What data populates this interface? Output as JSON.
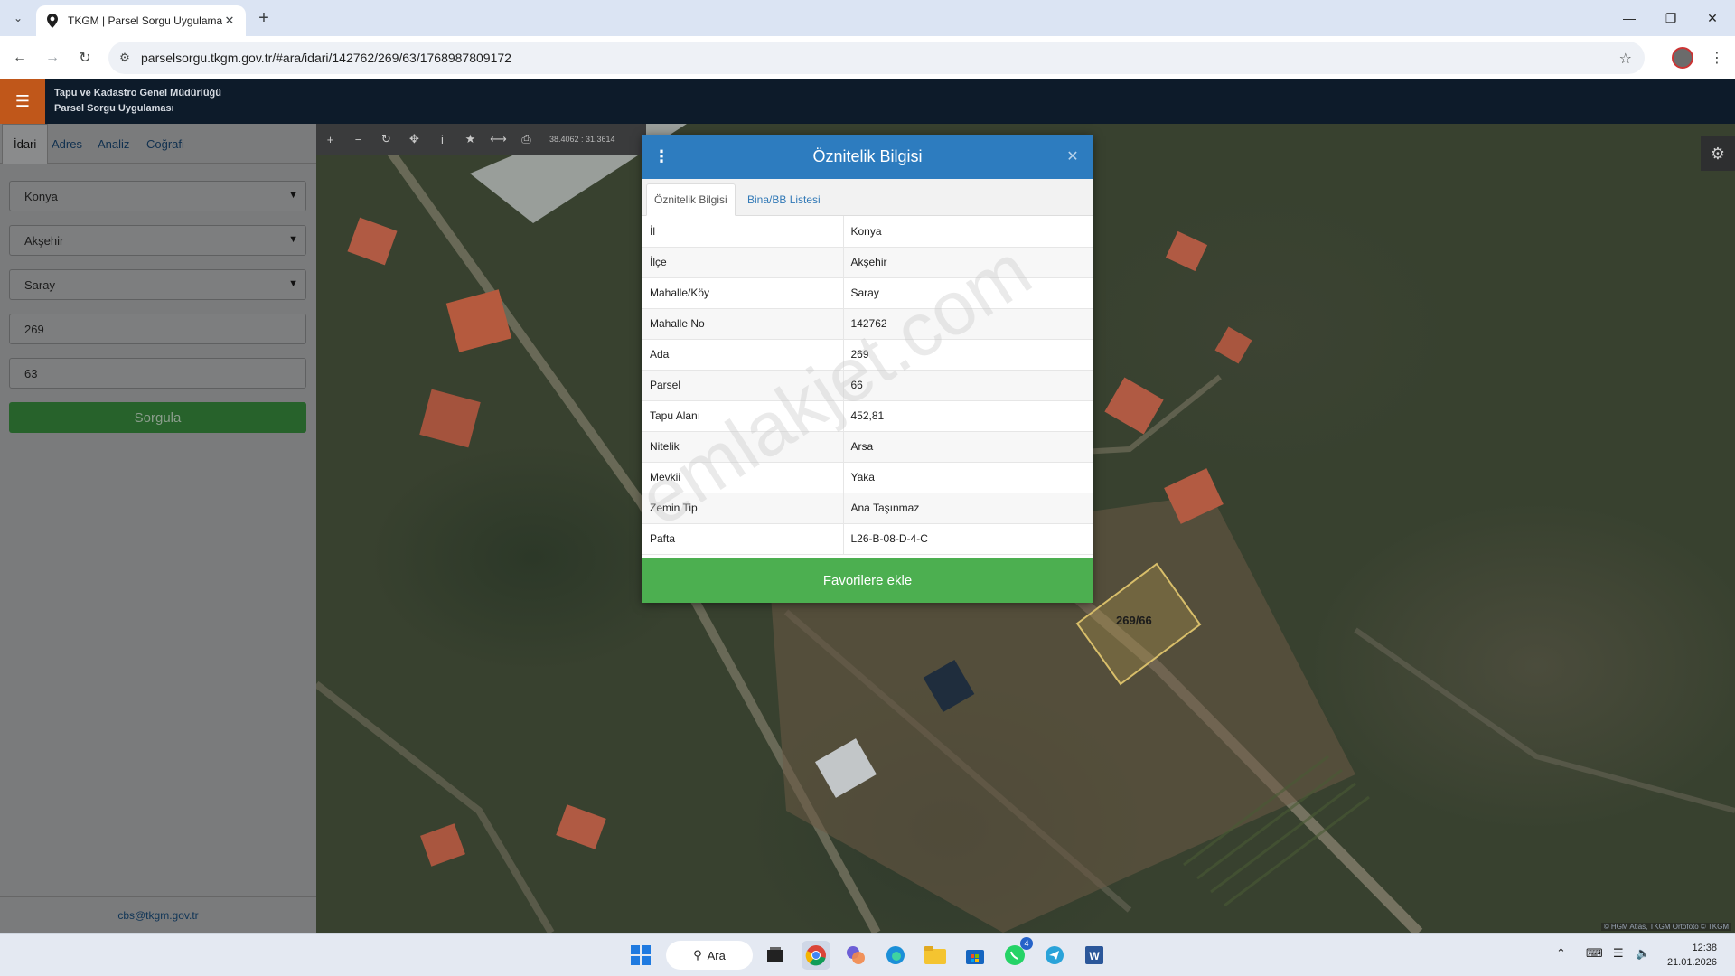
{
  "browser": {
    "tab_title": "TKGM | Parsel Sorgu Uygulama",
    "url": "parselsorgu.tkgm.gov.tr/#ara/idari/142762/269/63/1768987809172",
    "icons": [
      "tab-list-icon",
      "location-pin-icon",
      "close-icon",
      "plus-icon",
      "back-icon",
      "forward-icon",
      "reload-icon",
      "site-settings-icon",
      "bookmark-star-icon",
      "profile-avatar",
      "kebab-menu-icon",
      "minimize-icon",
      "maximize-icon",
      "window-close-icon"
    ]
  },
  "app": {
    "org": "Tapu ve Kadastro Genel Müdürlüğü",
    "name": "Parsel Sorgu Uygulaması",
    "accent_color": "#c0571a",
    "header_color": "#0d1b2a"
  },
  "left_panel": {
    "tabs": [
      "İdari",
      "Adres",
      "Analiz",
      "Coğrafi"
    ],
    "active_tab": "İdari",
    "il": "Konya",
    "ilce": "Akşehir",
    "mahalle": "Saray",
    "ada": "269",
    "parsel": "63",
    "query_button": "Sorgula",
    "footer_email": "cbs@tkgm.gov.tr"
  },
  "map": {
    "coordinates": "38.4062 : 31.3614",
    "parcel_label": "269/66",
    "attribution": "© HGM Atlas, TKGM Ortofoto © TKGM",
    "watermark": "emlakjet.com"
  },
  "popup": {
    "title": "Öznitelik Bilgisi",
    "tabs": [
      "Öznitelik Bilgisi",
      "Bina/BB Listesi"
    ],
    "active_tab": "Öznitelik Bilgisi",
    "rows": [
      {
        "key": "İl",
        "value": "Konya"
      },
      {
        "key": "İlçe",
        "value": "Akşehir"
      },
      {
        "key": "Mahalle/Köy",
        "value": "Saray"
      },
      {
        "key": "Mahalle No",
        "value": "142762"
      },
      {
        "key": "Ada",
        "value": "269"
      },
      {
        "key": "Parsel",
        "value": "66"
      },
      {
        "key": "Tapu Alanı",
        "value": "452,81"
      },
      {
        "key": "Nitelik",
        "value": "Arsa"
      },
      {
        "key": "Mevkii",
        "value": "Yaka"
      },
      {
        "key": "Zemin Tip",
        "value": "Ana Taşınmaz"
      },
      {
        "key": "Pafta",
        "value": "L26-B-08-D-4-C"
      }
    ],
    "favorite_button": "Favorilere ekle",
    "header_color": "#2d7cbf",
    "button_color": "#4caf50"
  },
  "taskbar": {
    "search_label": "Ara",
    "whatsapp_badge": "4",
    "time": "12:38",
    "date": "21.01.2026"
  }
}
